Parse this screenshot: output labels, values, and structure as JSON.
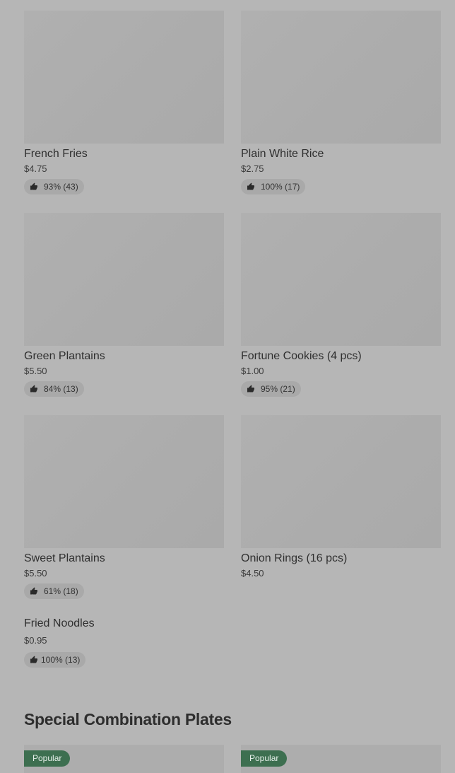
{
  "menu_items": [
    {
      "name": "French Fries",
      "price": "$4.75",
      "rating": "93% (43)"
    },
    {
      "name": "Plain White Rice",
      "price": "$2.75",
      "rating": "100% (17)"
    },
    {
      "name": "Green Plantains",
      "price": "$5.50",
      "rating": "84% (13)"
    },
    {
      "name": "Fortune Cookies (4 pcs)",
      "price": "$1.00",
      "rating": "95% (21)"
    },
    {
      "name": "Sweet Plantains",
      "price": "$5.50",
      "rating": "61% (18)"
    },
    {
      "name": "Onion Rings (16 pcs)",
      "price": "$4.50"
    },
    {
      "name": "Fried Noodles",
      "price": "$0.95",
      "rating": "100% (13)"
    }
  ],
  "section": {
    "title": "Special Combination Plates",
    "plates": [
      {
        "badge": "Popular"
      },
      {
        "badge": "Popular"
      }
    ]
  },
  "icons": {
    "rating": "thumbs-up-icon"
  },
  "colors": {
    "overlay_background": "#b6b6b6",
    "badge_background": "#3d6f50"
  }
}
